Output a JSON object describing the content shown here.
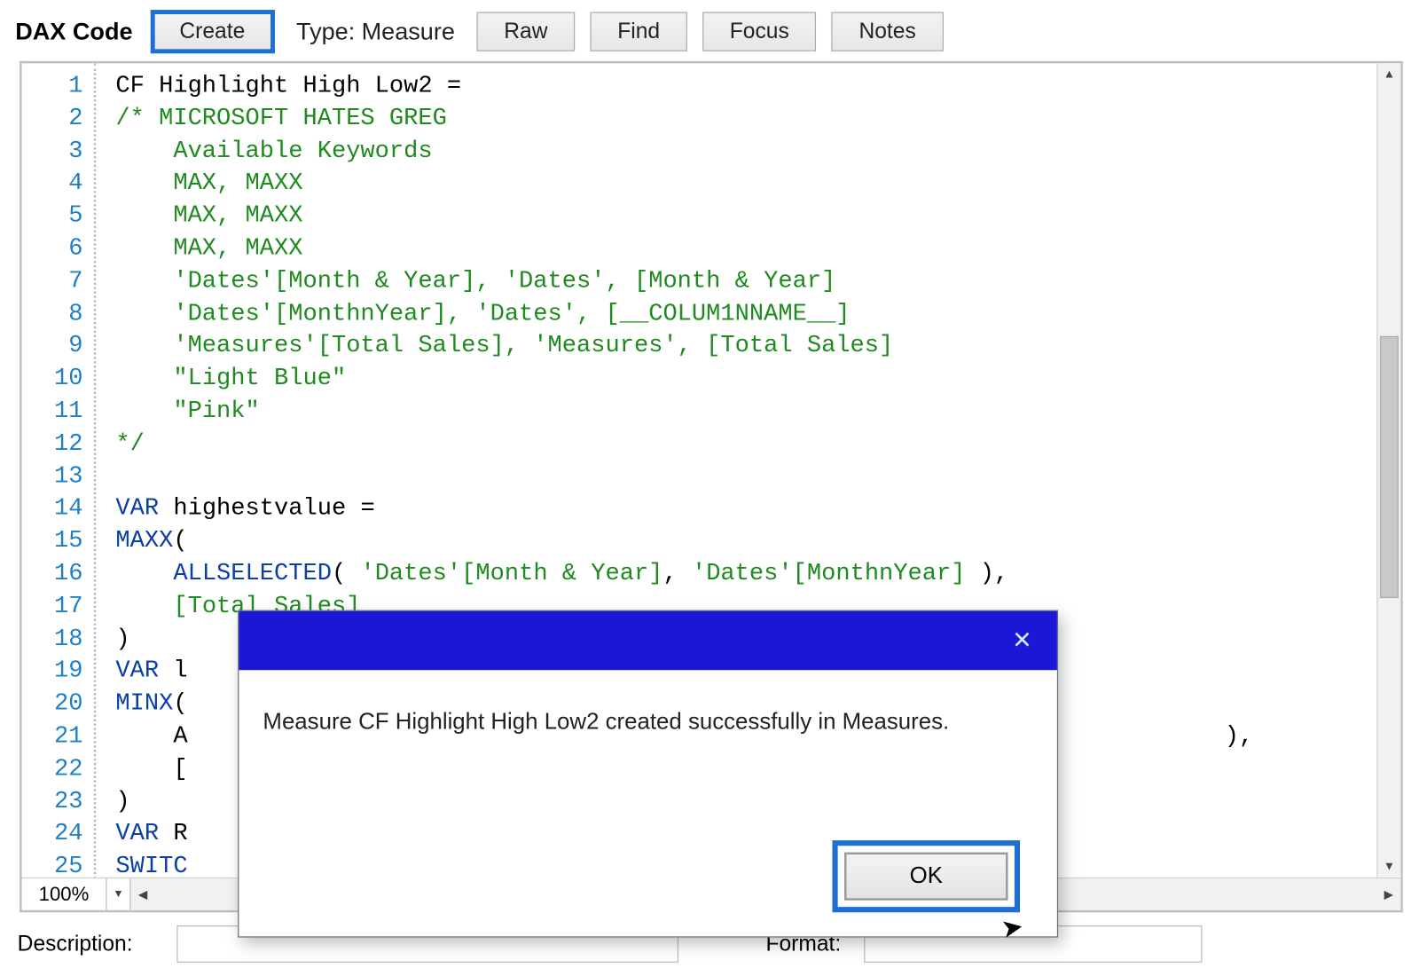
{
  "toolbar": {
    "title": "DAX Code",
    "create_label": "Create",
    "type_label": "Type:",
    "type_value": "Measure",
    "raw_label": "Raw",
    "find_label": "Find",
    "focus_label": "Focus",
    "notes_label": "Notes"
  },
  "editor": {
    "zoom": "100%",
    "lines": [
      [
        {
          "c": "ident",
          "t": "CF Highlight High Low2 ="
        }
      ],
      [
        {
          "c": "comment",
          "t": "/* MICROSOFT HATES GREG"
        }
      ],
      [
        {
          "c": "comment",
          "t": "    Available Keywords"
        }
      ],
      [
        {
          "c": "comment",
          "t": "    MAX, MAXX"
        }
      ],
      [
        {
          "c": "comment",
          "t": "    MAX, MAXX"
        }
      ],
      [
        {
          "c": "comment",
          "t": "    MAX, MAXX"
        }
      ],
      [
        {
          "c": "comment",
          "t": "    'Dates'[Month & Year], 'Dates', [Month & Year]"
        }
      ],
      [
        {
          "c": "comment",
          "t": "    'Dates'[MonthnYear], 'Dates', [__COLUM1NNAME__]"
        }
      ],
      [
        {
          "c": "comment",
          "t": "    'Measures'[Total Sales], 'Measures', [Total Sales]"
        }
      ],
      [
        {
          "c": "comment",
          "t": "    \"Light Blue\""
        }
      ],
      [
        {
          "c": "comment",
          "t": "    \"Pink\""
        }
      ],
      [
        {
          "c": "comment",
          "t": "*/"
        }
      ],
      [
        {
          "c": "ident",
          "t": ""
        }
      ],
      [
        {
          "c": "keyword",
          "t": "VAR"
        },
        {
          "c": "ident",
          "t": " highestvalue ="
        }
      ],
      [
        {
          "c": "keyword",
          "t": "MAXX"
        },
        {
          "c": "punct",
          "t": "("
        }
      ],
      [
        {
          "c": "ident",
          "t": "    "
        },
        {
          "c": "keyword",
          "t": "ALLSELECTED"
        },
        {
          "c": "punct",
          "t": "( "
        },
        {
          "c": "ref",
          "t": "'Dates'[Month & Year]"
        },
        {
          "c": "punct",
          "t": ", "
        },
        {
          "c": "ref",
          "t": "'Dates'[MonthnYear]"
        },
        {
          "c": "punct",
          "t": " ),"
        }
      ],
      [
        {
          "c": "ident",
          "t": "    "
        },
        {
          "c": "ref",
          "t": "[Total Sales]"
        }
      ],
      [
        {
          "c": "punct",
          "t": ")"
        }
      ],
      [
        {
          "c": "keyword",
          "t": "VAR"
        },
        {
          "c": "ident",
          "t": " l"
        }
      ],
      [
        {
          "c": "keyword",
          "t": "MINX"
        },
        {
          "c": "punct",
          "t": "("
        }
      ],
      [
        {
          "c": "ident",
          "t": "    A                                                                        ),"
        }
      ],
      [
        {
          "c": "ident",
          "t": "    ["
        }
      ],
      [
        {
          "c": "punct",
          "t": ")"
        }
      ],
      [
        {
          "c": "keyword",
          "t": "VAR"
        },
        {
          "c": "ident",
          "t": " R"
        }
      ],
      [
        {
          "c": "keyword",
          "t": "SWITC"
        }
      ]
    ]
  },
  "footer": {
    "description_label": "Description:",
    "format_label": "Format:"
  },
  "dialog": {
    "message": "Measure CF Highlight High Low2 created successfully in Measures.",
    "ok_label": "OK"
  }
}
